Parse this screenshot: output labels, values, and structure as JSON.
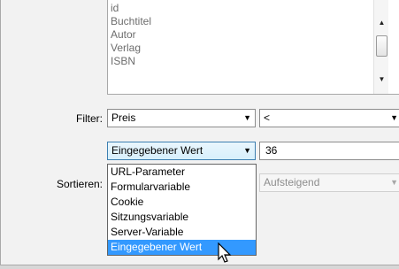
{
  "columns_list": {
    "items": [
      "id",
      "Buchtitel",
      "Autor",
      "Verlag",
      "ISBN"
    ]
  },
  "filter": {
    "label": "Filter:",
    "column_value": "Preis",
    "operator_value": "<",
    "source_value": "Eingegebener Wert",
    "input_value": "36",
    "source_options": [
      "URL-Parameter",
      "Formularvariable",
      "Cookie",
      "Sitzungsvariable",
      "Server-Variable",
      "Eingegebener Wert"
    ],
    "selected_option": "Eingegebener Wert"
  },
  "sort": {
    "label": "Sortieren:",
    "order_value": "Aufsteigend"
  },
  "icons": {
    "dropdown_arrow": "triangle-down",
    "scroll_up": "triangle-up",
    "scroll_down": "triangle-down",
    "cursor": "arrow-pointer"
  }
}
